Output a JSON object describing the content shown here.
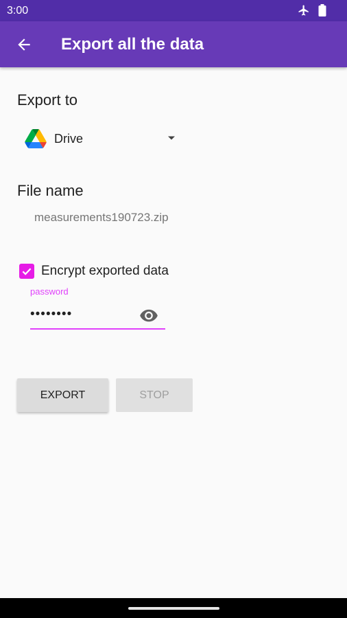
{
  "status_bar": {
    "time": "3:00",
    "icons": [
      "airplane-icon",
      "battery-icon"
    ]
  },
  "app_bar": {
    "title": "Export all the data",
    "back_icon": "arrow-back-icon"
  },
  "export_to": {
    "label": "Export to",
    "selected_destination": "Drive",
    "destination_icon": "google-drive-icon"
  },
  "file_name": {
    "label": "File name",
    "value": "measurements190723.zip"
  },
  "encrypt": {
    "checkbox_label": "Encrypt exported data",
    "checked": true,
    "password_label": "password",
    "password_value": "••••••••"
  },
  "actions": {
    "export_label": "EXPORT",
    "stop_label": "STOP"
  },
  "colors": {
    "status_bar": "#512da8",
    "app_bar": "#673ab7",
    "accent": "#e040fb"
  }
}
